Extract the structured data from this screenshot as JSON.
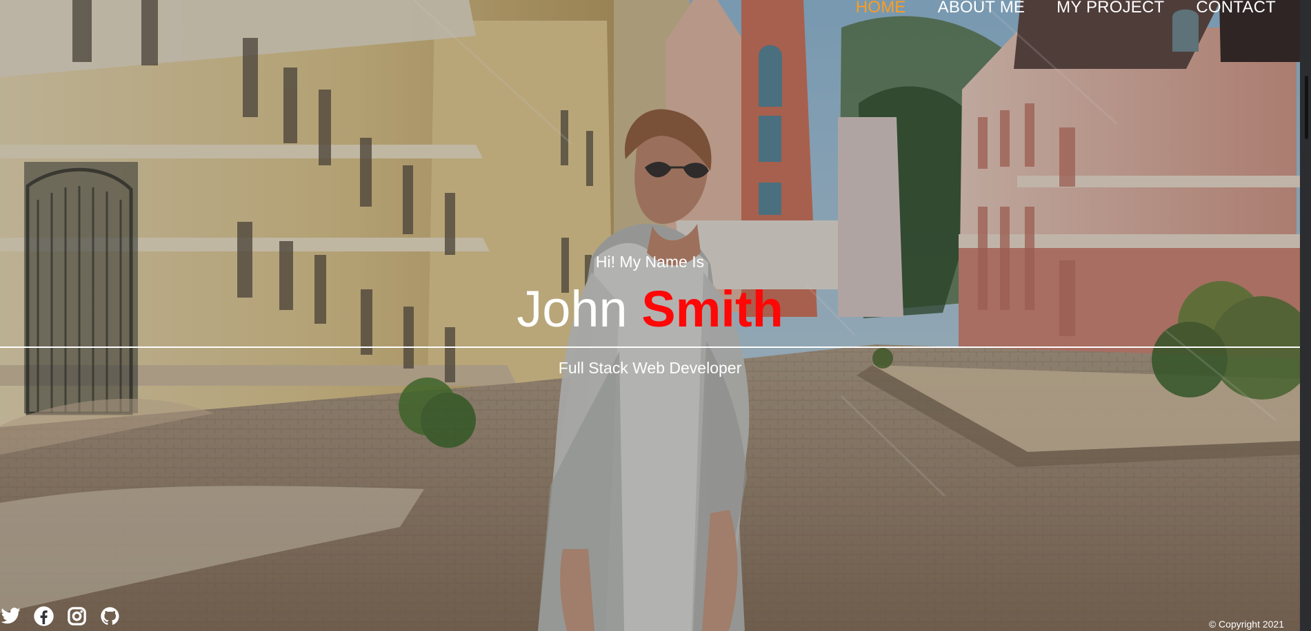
{
  "nav": {
    "items": [
      "HOME",
      "ABOUT ME",
      "MY PROJECT",
      "CONTACT"
    ],
    "active": "HOME",
    "active_color": "#ff9d1c"
  },
  "hero": {
    "greeting": "Hi! My Name Is",
    "first_name": "John",
    "last_name": "Smith",
    "last_name_color": "#ff0707",
    "role": "Full Stack Web Developer"
  },
  "social": {
    "icons": [
      "twitter-icon",
      "facebook-icon",
      "instagram-icon",
      "github-icon"
    ]
  },
  "footer": {
    "copyright": "© Copyright 2021"
  }
}
